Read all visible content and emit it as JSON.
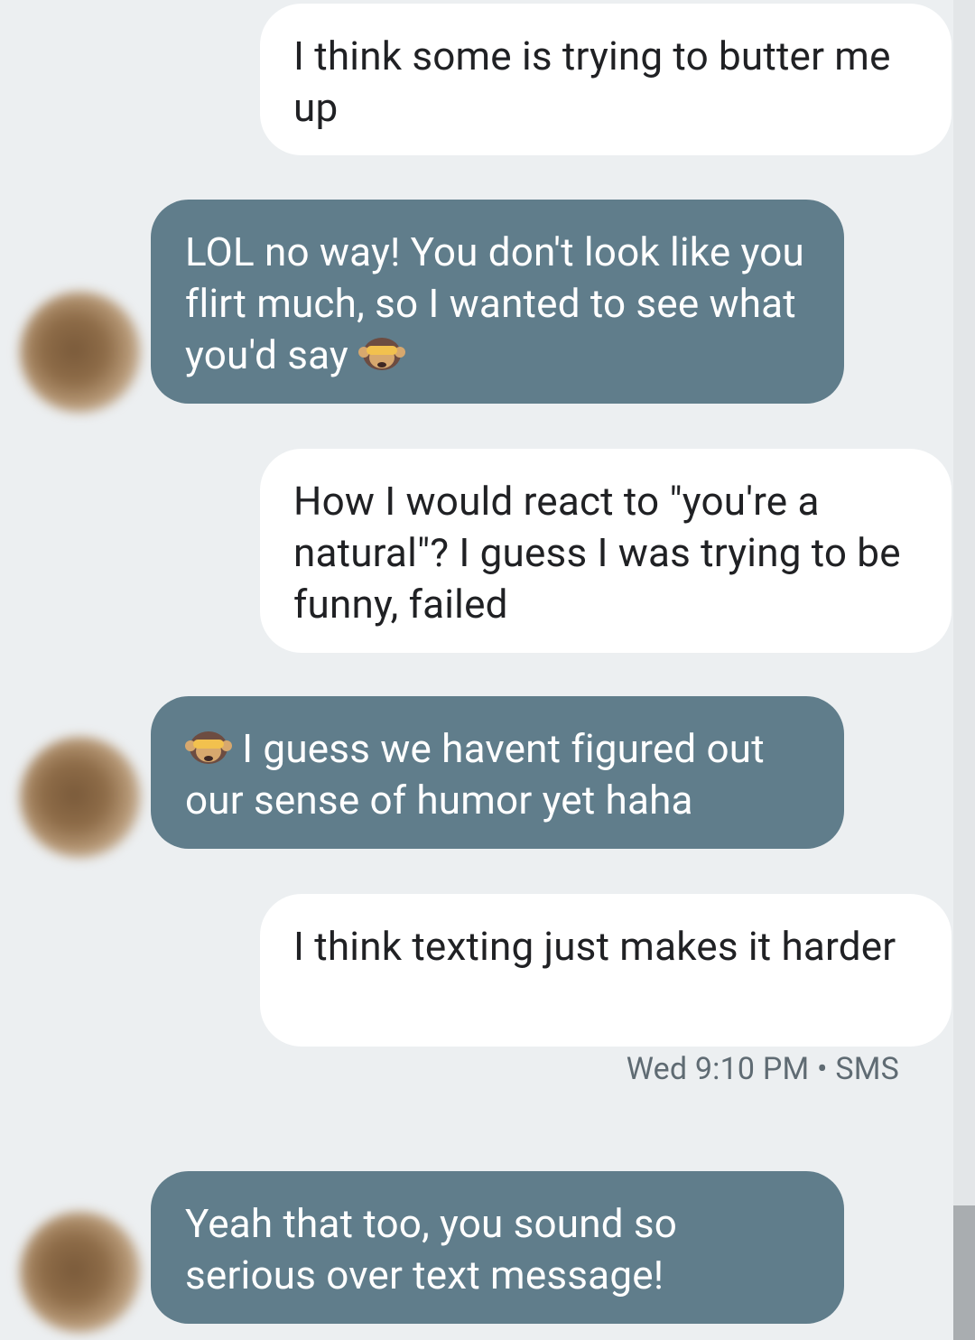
{
  "messages": [
    {
      "direction": "out",
      "text": "I think some is trying to butter me up"
    },
    {
      "direction": "in",
      "text": "LOL no way! You don't look like you flirt much, so I wanted to see what you'd say",
      "emoji": "see-no-evil-monkey-icon"
    },
    {
      "direction": "out",
      "text": "How I would react to \"you're a natural\"? I guess I was trying to be funny, failed"
    },
    {
      "direction": "in",
      "text": "I guess we havent figured out our sense of humor yet haha",
      "emoji": "see-no-evil-monkey-icon"
    },
    {
      "direction": "out",
      "text": "I think texting just makes it harder"
    },
    {
      "direction": "in",
      "text": "Yeah that too, you sound so serious over text message!"
    }
  ],
  "meta": {
    "timestamp": "Wed 9:10 PM",
    "separator": "•",
    "type": "SMS"
  },
  "colors": {
    "background": "#eceff1",
    "incoming_bubble": "#607d8b",
    "outgoing_bubble": "#ffffff",
    "outgoing_text": "#202124"
  }
}
